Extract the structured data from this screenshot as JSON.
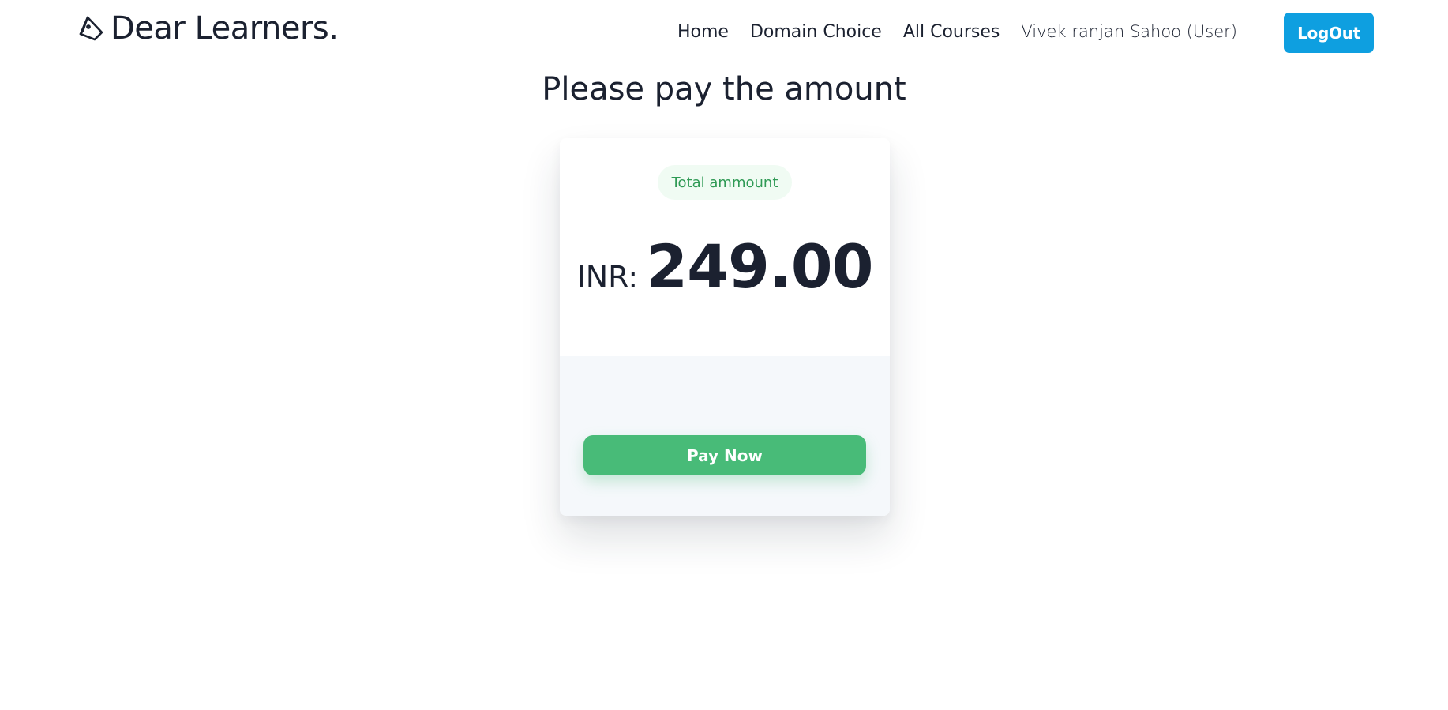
{
  "navbar": {
    "brand": "Dear Learners.",
    "brand_icon": "tag-icon",
    "links": [
      "Home",
      "Domain Choice",
      "All Courses"
    ],
    "user": "Vivek ranjan Sahoo (User)",
    "logout_label": "LogOut"
  },
  "page": {
    "title": "Please pay the amount"
  },
  "payment": {
    "badge": "Total ammount",
    "currency": "INR:",
    "amount": "249.00",
    "pay_label": "Pay Now"
  },
  "colors": {
    "accent": "#0e9fe0",
    "pay_button": "#48bb78",
    "badge_text": "#2f9a55",
    "badge_bg": "#f0fbf3",
    "text": "#1b2130"
  }
}
